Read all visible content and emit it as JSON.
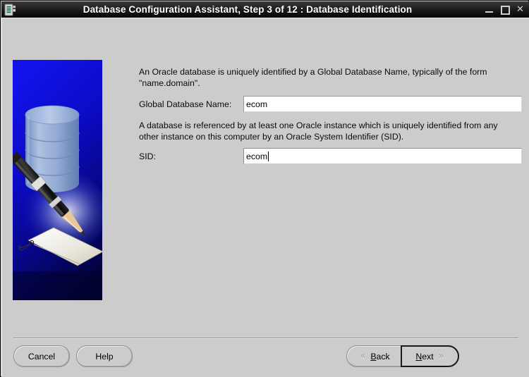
{
  "window": {
    "title": "Database Configuration Assistant, Step 3 of 12 : Database Identification",
    "icon": "database-assistant-icon",
    "controls": {
      "minimize": "_",
      "maximize": "□",
      "close": "✕"
    }
  },
  "graphic": {
    "name": "oracle-database-identification-illustration",
    "background_color": "#0d0dd0",
    "cylinder_color": "#93aed6"
  },
  "main": {
    "paragraph1": "An Oracle database is uniquely identified by a Global Database Name, typically of the form \"name.domain\".",
    "paragraph2": "A database is referenced by at least one Oracle instance which is uniquely identified from any other instance on this computer by an Oracle System Identifier (SID).",
    "fields": [
      {
        "label": "Global Database Name:",
        "value": "ecom",
        "placeholder": "",
        "focused": false
      },
      {
        "label": "SID:",
        "value": "ecom",
        "placeholder": "",
        "focused": true
      }
    ]
  },
  "footer": {
    "cancel_label": "Cancel",
    "help_label": "Help",
    "back": {
      "label": "Back",
      "mnemonic": "B",
      "prefix": "",
      "suffix": "ack",
      "chevron": "«"
    },
    "next": {
      "label": "Next",
      "mnemonic": "N",
      "prefix": "",
      "suffix": "ext",
      "chevron": "»"
    }
  }
}
